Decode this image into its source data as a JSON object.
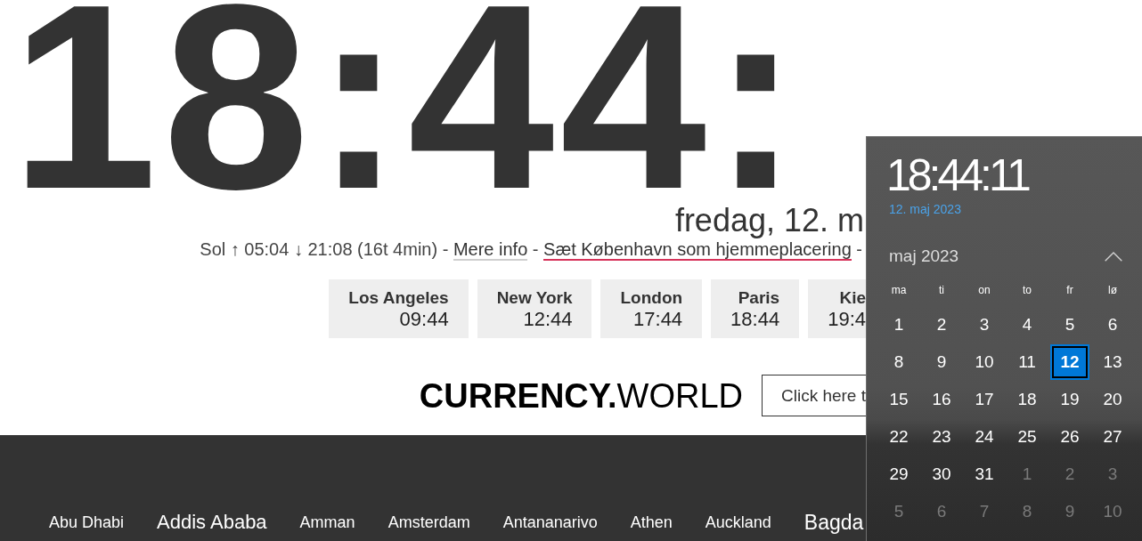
{
  "big_clock": {
    "time": "18:44:"
  },
  "date_heading": "fredag, 12. m",
  "sun_info": [
    {
      "kind": "text",
      "text": "Sol ↑ 05:04 ↓ 21:08 (16t 4min) - "
    },
    {
      "kind": "link",
      "text": "Mere info"
    },
    {
      "kind": "text",
      "text": " - "
    },
    {
      "kind": "home_link",
      "text": "Sæt København som hjemmeplacering"
    },
    {
      "kind": "text",
      "text": " -"
    }
  ],
  "cities": [
    {
      "name": "Los Angeles",
      "time": "09:44"
    },
    {
      "name": "New York",
      "time": "12:44"
    },
    {
      "name": "London",
      "time": "17:44"
    },
    {
      "name": "Paris",
      "time": "18:44"
    },
    {
      "name": "Kie",
      "time": "19:4"
    }
  ],
  "currency_banner": {
    "logo": "**CURRENCY.**WORLD",
    "button": "Click here t"
  },
  "footer": {
    "links": [
      {
        "label": "Abu Dhabi",
        "kind": "normal"
      },
      {
        "label": "Addis Ababa",
        "kind": "large"
      },
      {
        "label": "Amman",
        "kind": "normal"
      },
      {
        "label": "Amsterdam",
        "kind": "normal"
      },
      {
        "label": "Antananarivo",
        "kind": "normal"
      },
      {
        "label": "Athen",
        "kind": "normal"
      },
      {
        "label": "Auckland",
        "kind": "normal"
      },
      {
        "label": "Bagda",
        "kind": "xlarge"
      }
    ]
  },
  "calendar_flyout": {
    "time": "18:44:11",
    "date": "12. maj 2023",
    "month_label": "maj 2023",
    "weekdays": [
      "ma",
      "ti",
      "on",
      "to",
      "fr",
      "lø"
    ],
    "weeks": [
      [
        {
          "day": "1",
          "in_month": true,
          "selected": false
        },
        {
          "day": "2",
          "in_month": true,
          "selected": false
        },
        {
          "day": "3",
          "in_month": true,
          "selected": false
        },
        {
          "day": "4",
          "in_month": true,
          "selected": false
        },
        {
          "day": "5",
          "in_month": true,
          "selected": false
        },
        {
          "day": "6",
          "in_month": true,
          "selected": false
        }
      ],
      [
        {
          "day": "8",
          "in_month": true,
          "selected": false
        },
        {
          "day": "9",
          "in_month": true,
          "selected": false
        },
        {
          "day": "10",
          "in_month": true,
          "selected": false
        },
        {
          "day": "11",
          "in_month": true,
          "selected": false
        },
        {
          "day": "12",
          "in_month": true,
          "selected": true
        },
        {
          "day": "13",
          "in_month": true,
          "selected": false
        }
      ],
      [
        {
          "day": "15",
          "in_month": true,
          "selected": false
        },
        {
          "day": "16",
          "in_month": true,
          "selected": false
        },
        {
          "day": "17",
          "in_month": true,
          "selected": false
        },
        {
          "day": "18",
          "in_month": true,
          "selected": false
        },
        {
          "day": "19",
          "in_month": true,
          "selected": false
        },
        {
          "day": "20",
          "in_month": true,
          "selected": false
        }
      ],
      [
        {
          "day": "22",
          "in_month": true,
          "selected": false
        },
        {
          "day": "23",
          "in_month": true,
          "selected": false
        },
        {
          "day": "24",
          "in_month": true,
          "selected": false
        },
        {
          "day": "25",
          "in_month": true,
          "selected": false
        },
        {
          "day": "26",
          "in_month": true,
          "selected": false
        },
        {
          "day": "27",
          "in_month": true,
          "selected": false
        }
      ],
      [
        {
          "day": "29",
          "in_month": true,
          "selected": false
        },
        {
          "day": "30",
          "in_month": true,
          "selected": false
        },
        {
          "day": "31",
          "in_month": true,
          "selected": false
        },
        {
          "day": "1",
          "in_month": false,
          "selected": false
        },
        {
          "day": "2",
          "in_month": false,
          "selected": false
        },
        {
          "day": "3",
          "in_month": false,
          "selected": false
        }
      ],
      [
        {
          "day": "5",
          "in_month": false,
          "selected": false
        },
        {
          "day": "6",
          "in_month": false,
          "selected": false
        },
        {
          "day": "7",
          "in_month": false,
          "selected": false
        },
        {
          "day": "8",
          "in_month": false,
          "selected": false
        },
        {
          "day": "9",
          "in_month": false,
          "selected": false
        },
        {
          "day": "10",
          "in_month": false,
          "selected": false
        }
      ]
    ]
  }
}
